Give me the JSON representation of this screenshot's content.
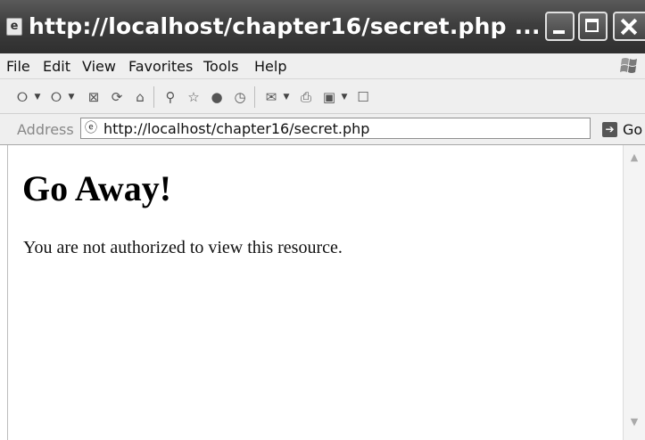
{
  "window": {
    "title": "http://localhost/chapter16/secret.php ..."
  },
  "menu": {
    "items": [
      "File",
      "Edit",
      "View",
      "Favorites",
      "Tools",
      "Help"
    ]
  },
  "toolbar": {
    "buttons": [
      "back",
      "forward",
      "stop",
      "refresh",
      "home",
      "search",
      "favorites",
      "media",
      "history",
      "mail",
      "print",
      "edit",
      "discuss"
    ]
  },
  "address": {
    "label": "Address",
    "url": "http://localhost/chapter16/secret.php",
    "go_label": "Go"
  },
  "page": {
    "heading": "Go Away!",
    "message": "You are not authorized to view this resource."
  }
}
